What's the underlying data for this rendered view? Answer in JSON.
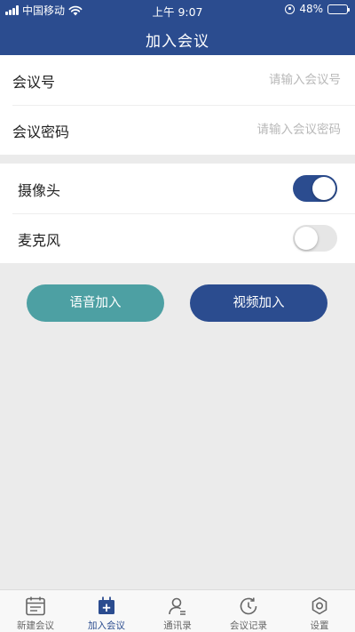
{
  "status_bar": {
    "carrier": "中国移动",
    "time": "上午 9:07",
    "battery": "48%",
    "battery_level": 0.48
  },
  "header": {
    "title": "加入会议"
  },
  "form": {
    "meeting_id": {
      "label": "会议号",
      "placeholder": "请输入会议号",
      "value": ""
    },
    "meeting_password": {
      "label": "会议密码",
      "placeholder": "请输入会议密码",
      "value": ""
    }
  },
  "toggles": {
    "camera": {
      "label": "摄像头",
      "on": true
    },
    "microphone": {
      "label": "麦克风",
      "on": false
    }
  },
  "actions": {
    "voice_join": "语音加入",
    "video_join": "视频加入"
  },
  "colors": {
    "primary": "#2b4c8f",
    "voice_button": "#4da0a3",
    "background": "#ebebeb"
  },
  "tabbar": {
    "active": "join-meeting",
    "items": [
      {
        "id": "new-meeting",
        "label": "新建会议",
        "icon": "calendar-icon"
      },
      {
        "id": "join-meeting",
        "label": "加入会议",
        "icon": "join-meeting-icon"
      },
      {
        "id": "contacts",
        "label": "通讯录",
        "icon": "contacts-icon"
      },
      {
        "id": "history",
        "label": "会议记录",
        "icon": "history-icon"
      },
      {
        "id": "settings",
        "label": "设置",
        "icon": "settings-gear-icon"
      }
    ]
  }
}
